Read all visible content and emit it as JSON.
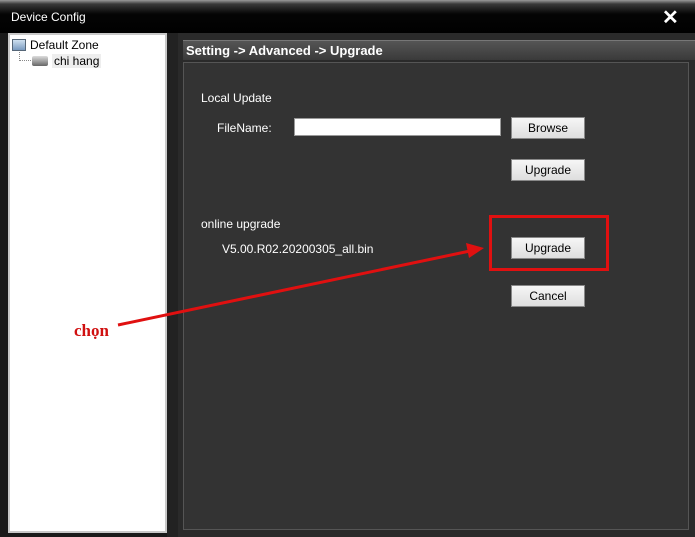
{
  "window": {
    "title": "Device Config",
    "close_icon": "close-icon"
  },
  "tree": {
    "root": "Default Zone",
    "child": "chi hang"
  },
  "header": {
    "breadcrumb": "Setting -> Advanced -> Upgrade"
  },
  "local_update": {
    "section_label": "Local Update",
    "filename_label": "FileName:",
    "filename_value": "",
    "browse_label": "Browse",
    "upgrade_label": "Upgrade"
  },
  "online_upgrade": {
    "section_label": "online upgrade",
    "version": "V5.00.R02.20200305_all.bin",
    "upgrade_label": "Upgrade",
    "cancel_label": "Cancel"
  },
  "annotation": {
    "text": "chọn",
    "color": "#e01010"
  }
}
